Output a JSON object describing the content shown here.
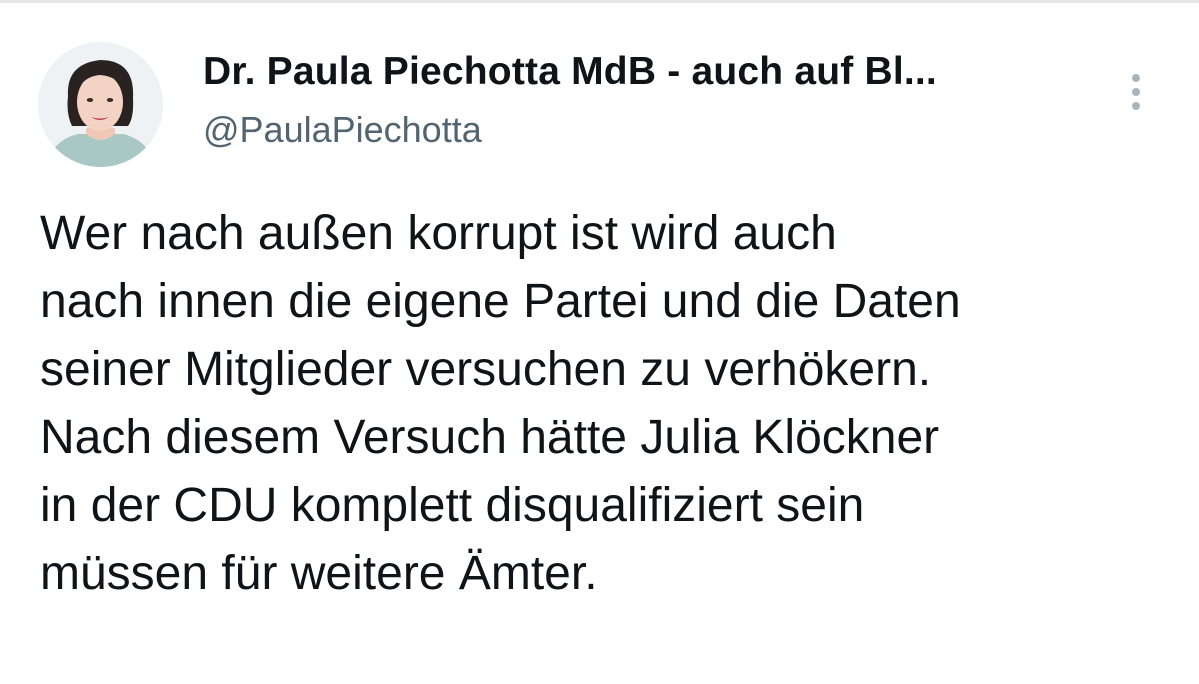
{
  "author": {
    "display_name": "Dr. Paula Piechotta MdB - auch auf Bl...",
    "handle": "@PaulaPiechotta"
  },
  "tweet": {
    "lines": [
      "Wer nach außen korrupt ist wird auch",
      "nach innen die eigene Partei und die Daten",
      "seiner Mitglieder versuchen zu verhökern.",
      "Nach diesem Versuch hätte Julia Klöckner",
      "in der CDU komplett disqualifiziert sein",
      "müssen für weitere Ämter."
    ]
  },
  "icons": {
    "more": "more-vertical-icon",
    "avatar": "profile-photo"
  },
  "colors": {
    "text": "#0f1419",
    "secondary_text": "#536471",
    "icon": "#aab4bd"
  }
}
